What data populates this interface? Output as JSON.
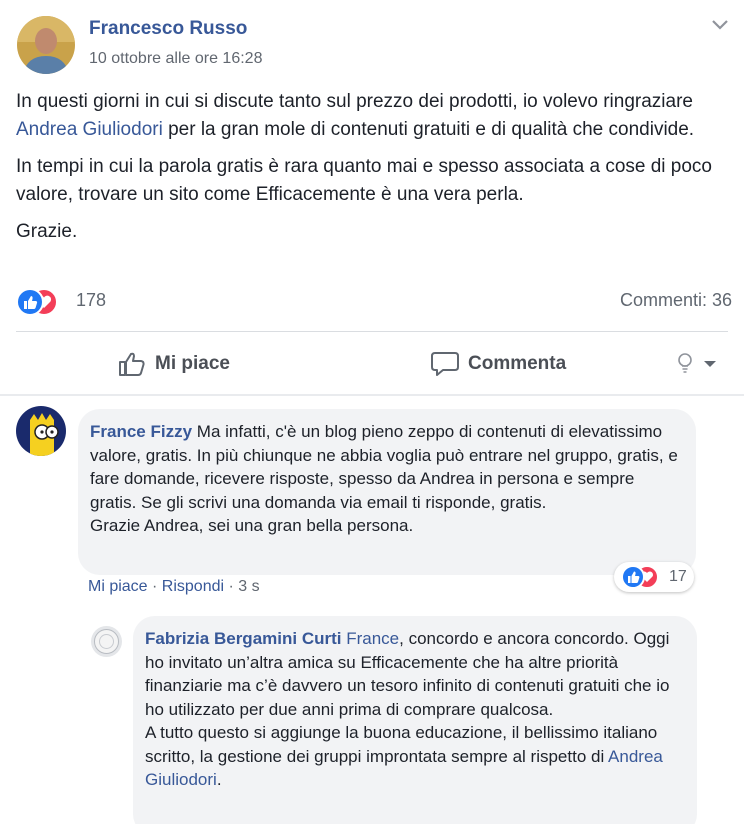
{
  "post": {
    "author": "Francesco Russo",
    "timestamp": "10 ottobre alle ore 16:28",
    "paragraphs": [
      {
        "before": "In questi giorni in cui si discute tanto sul prezzo dei prodotti, io volevo ringraziare ",
        "link": "Andrea Giuliodori",
        "after": " per la gran mole di contenuti gratuiti e di qualità che condivide."
      },
      {
        "text": "In tempi in cui la parola gratis è rara quanto mai e spesso associata a cose di poco valore, trovare un sito come Efficacemente è una vera perla."
      },
      {
        "text": "Grazie."
      }
    ],
    "reactions_count": "178",
    "comments_label": "Commenti: 36"
  },
  "actions": {
    "like": "Mi piace",
    "comment": "Commenta"
  },
  "comments": [
    {
      "author": "France Fizzy",
      "text_lines": [
        "Ma infatti, c'è un blog pieno zeppo di contenuti di elevatissimo valore, gratis. In più chiunque ne abbia voglia può entrare nel gruppo, gratis, e fare domande, ricevere risposte, spesso da Andrea in persona e sempre gratis. Se gli scrivi una domanda via email ti risponde, gratis.",
        "Grazie Andrea, sei una gran bella persona."
      ],
      "like_action": "Mi piace",
      "reply_action": "Rispondi",
      "time": "3 s",
      "reactions_count": "17"
    },
    {
      "author": "Fabrizia Bergamini Curti",
      "mention": "France",
      "text_a": ", concordo e ancora concordo. Oggi ho invitato un’altra amica su Efficacemente che ha altre priorità finanziarie ma c’è davvero un tesoro infinito di contenuti gratuiti che io ho utilizzato per due anni prima di comprare qualcosa.",
      "text_b": "A tutto questo si aggiunge la buona educazione, il bellissimo italiano scritto, la gestione dei gruppi improntata sempre al rispetto di ",
      "link": "Andrea Giuliodori",
      "text_end": "."
    }
  ],
  "colors": {
    "link": "#385898",
    "like_blue": "#2078f4",
    "love_red": "#f33e58",
    "bubble_bg": "#f2f3f5"
  }
}
